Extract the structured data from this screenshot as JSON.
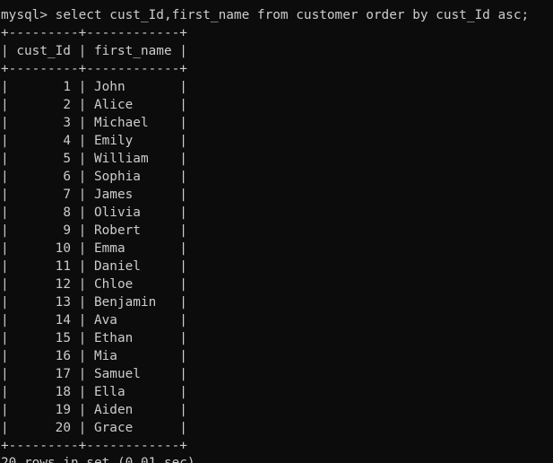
{
  "prompt": "mysql>",
  "command": "select cust_Id,first_name from customer order by cust_Id asc;",
  "columns": [
    "cust_Id",
    "first_name"
  ],
  "rows": [
    [
      "1",
      "John"
    ],
    [
      "2",
      "Alice"
    ],
    [
      "3",
      "Michael"
    ],
    [
      "4",
      "Emily"
    ],
    [
      "5",
      "William"
    ],
    [
      "6",
      "Sophia"
    ],
    [
      "7",
      "James"
    ],
    [
      "8",
      "Olivia"
    ],
    [
      "9",
      "Robert"
    ],
    [
      "10",
      "Emma"
    ],
    [
      "11",
      "Daniel"
    ],
    [
      "12",
      "Chloe"
    ],
    [
      "13",
      "Benjamin"
    ],
    [
      "14",
      "Ava"
    ],
    [
      "15",
      "Ethan"
    ],
    [
      "16",
      "Mia"
    ],
    [
      "17",
      "Samuel"
    ],
    [
      "18",
      "Ella"
    ],
    [
      "19",
      "Aiden"
    ],
    [
      "20",
      "Grace"
    ]
  ],
  "result_summary": "20 rows in set (0.01 sec)",
  "colors": {
    "background": "#0c0c0c",
    "text": "#cccccc"
  }
}
